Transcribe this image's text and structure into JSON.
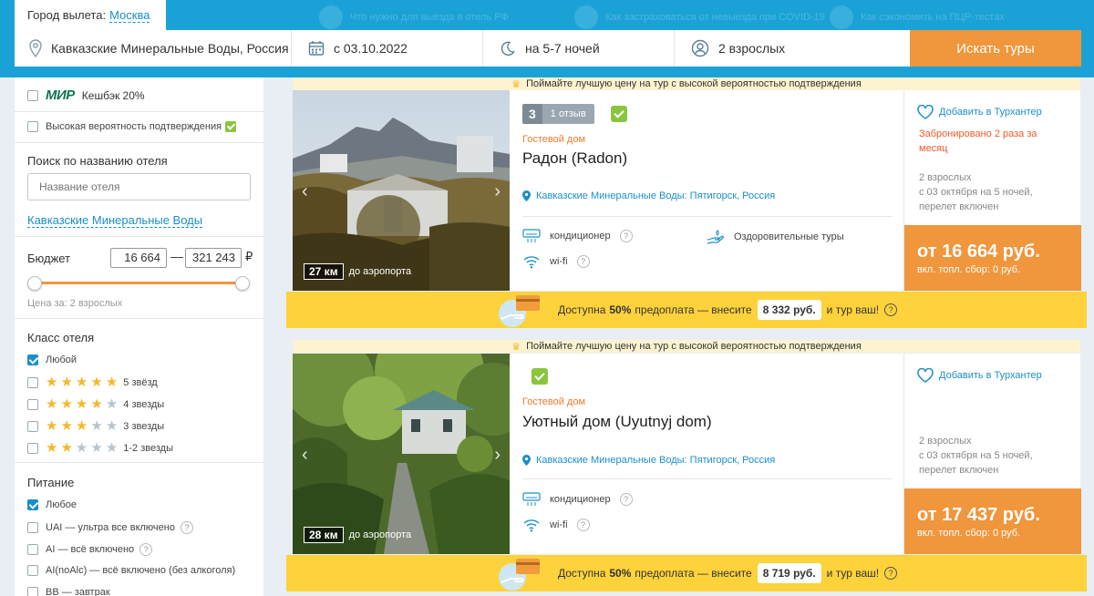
{
  "header": {
    "city_label": "Город вылета:",
    "city_value": "Москва",
    "promos": [
      "Что нужно для выезда в отель РФ",
      "Как застраховаться от невыезда при COVID-19",
      "Как сэкономить на ПЦР-тестах"
    ]
  },
  "search": {
    "destination": "Кавказские Минеральные Воды, Россия",
    "date": "с 03.10.2022",
    "nights": "на 5-7 ночей",
    "guests": "2 взрослых",
    "button": "Искать туры"
  },
  "sidebar": {
    "cashback": "Кешбэк 20%",
    "mir_logo": "МИР",
    "high_confirm": "Высокая вероятность подтверждения",
    "hotel_search_title": "Поиск по названию отеля",
    "hotel_search_placeholder": "Название отеля",
    "region_link": "Кавказские Минеральные Воды",
    "budget_title": "Бюджет",
    "budget_min": "16 664",
    "budget_sep": "—",
    "budget_max": "321 243",
    "currency": "₽",
    "price_note": "Цена за: 2 взрослых",
    "class_title": "Класс отеля",
    "class_any": "Любой",
    "class_options": [
      "5 звёзд",
      "4 звезды",
      "3 звезды",
      "1-2 звезды"
    ],
    "class_stars": [
      5,
      4,
      3,
      2
    ],
    "meal_title": "Питание",
    "meal_any": "Любое",
    "meal_options": [
      "UAI — ультра все включено",
      "AI — всё включено",
      "AI(noAlc) — всё включено (без алкоголя)",
      "BB — завтрак"
    ]
  },
  "results": [
    {
      "banner": "Поймайте лучшую цену на тур с высокой вероятностью подтверждения",
      "distance": "27 км",
      "distance_label": "до аэропорта",
      "score": "3",
      "reviews": "1 отзыв",
      "type": "Гостевой дом",
      "name": "Радон (Radon)",
      "location": "Кавказские Минеральные Воды: Пятигорск, Россия",
      "amenity_1": "кондиционер",
      "amenity_2": "wi-fi",
      "amenity_3": "Оздоровительные туры",
      "fav": "Добавить в Турхантер",
      "booked": "Забронировано 2 раза за месяц",
      "meta_guests": "2 взрослых",
      "meta_dates": "с 03 октября на 5 ночей,",
      "meta_flight": "перелет включен",
      "price": "от 16 664 руб.",
      "price_note": "вкл. топл. сбор: 0 руб.",
      "pay_prefix": "Доступна",
      "pay_pct": "50%",
      "pay_mid": "предоплата — внесите",
      "pay_amount": "8 332 руб.",
      "pay_suffix": "и тур ваш!"
    },
    {
      "banner": "Поймайте лучшую цену на тур с высокой вероятностью подтверждения",
      "distance": "28 км",
      "distance_label": "до аэропорта",
      "type": "Гостевой дом",
      "name": "Уютный дом (Uyutnyj dom)",
      "location": "Кавказские Минеральные Воды: Пятигорск, Россия",
      "amenity_1": "кондиционер",
      "amenity_2": "wi-fi",
      "fav": "Добавить в Турхантер",
      "meta_guests": "2 взрослых",
      "meta_dates": "с 03 октября на 5 ночей,",
      "meta_flight": "перелет включен",
      "price": "от 17 437 руб.",
      "price_note": "вкл. топл. сбор: 0 руб.",
      "pay_prefix": "Доступна",
      "pay_pct": "50%",
      "pay_mid": "предоплата — внесите",
      "pay_amount": "8 719 руб.",
      "pay_suffix": "и тур ваш!"
    }
  ],
  "colors": {
    "brand": "#1aa2d6",
    "accent": "#f0963c",
    "pay": "#fdd23a",
    "ok": "#8bc53f"
  }
}
